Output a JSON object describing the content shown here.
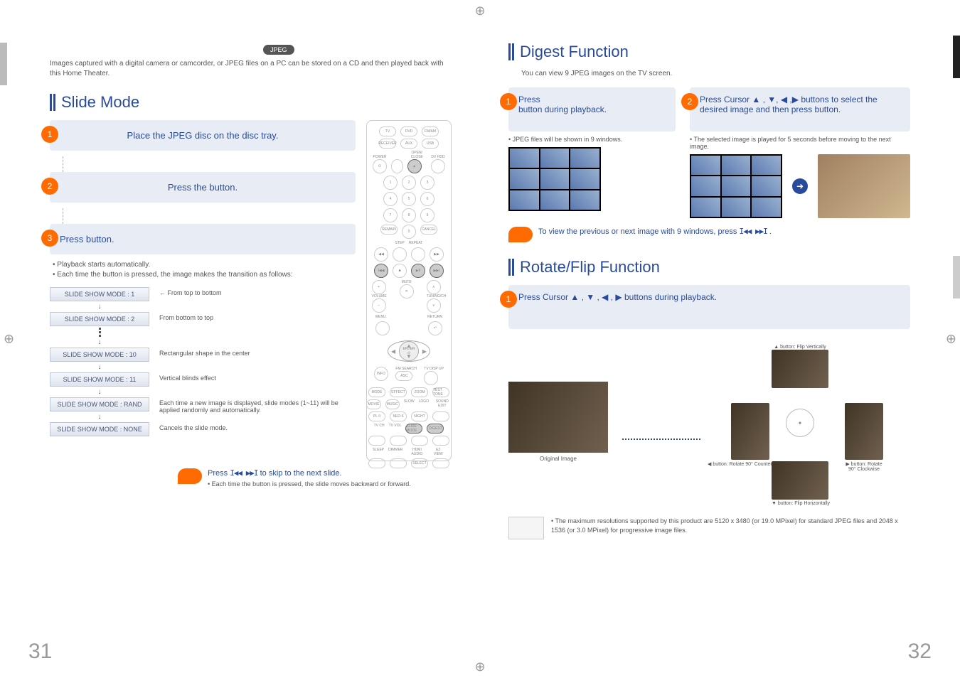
{
  "left": {
    "jpeg_badge": "JPEG",
    "intro": "Images captured with a digital camera or camcorder, or JPEG files on a PC can be stored on a CD and then played back with this Home Theater.",
    "section_title": "Slide Mode",
    "step1": "Place the JPEG disc on the disc tray.",
    "step2_pre": "Press the ",
    "step2_post": " button.",
    "step3_pre": "Press ",
    "step3_post": " button.",
    "bullet1": "• Playback starts automatically.",
    "bullet2": "• Each time the button is pressed, the image makes the transition as follows:",
    "modes": {
      "m1": "SLIDE SHOW MODE : 1",
      "d1": "From top to bottom",
      "m2": "SLIDE SHOW MODE : 2",
      "d2": "From bottom to top",
      "m10": "SLIDE SHOW MODE : 10",
      "d10": "Rectangular shape in the center",
      "m11": "SLIDE SHOW MODE : 11",
      "d11": "Vertical blinds effect",
      "mr": "SLIDE SHOW MODE : RAND",
      "dr": "Each time a new image is displayed, slide modes (1~11) will be applied randomly and automatically.",
      "mn": "SLIDE SHOW MODE : NONE",
      "dn": "Cancels the slide mode."
    },
    "tip_press_pre": "Press ",
    "tip_press_post": " to skip to the next slide.",
    "tip_detail": "• Each time the button is pressed, the slide moves backward or forward.",
    "page_num": "31",
    "remote": {
      "tv": "TV",
      "dvd": "DVD",
      "fmam": "FM/AM",
      "receiver": "RECEIVER",
      "aux": "AUX",
      "usb": "USB",
      "power": "POWER",
      "openclose": "OPEN/\nCLOSE",
      "dvhdd": "DV HDD",
      "numbers": [
        "1",
        "2",
        "3",
        "4",
        "5",
        "6",
        "7",
        "8",
        "9",
        "0"
      ],
      "remain": "REMAIN",
      "cancel": "CANCEL",
      "step": "STEP",
      "repeat": "REPEAT",
      "mute": "MUTE",
      "volume": "VOLUME",
      "tuning": "TUNING/CH",
      "menu": "MENU",
      "return": "RETURN",
      "enter": "ENTER",
      "info": "INFO",
      "fmsearch": "FM SEARCH",
      "tvdispup": "TV DISP UP",
      "asc": "ASC",
      "mode": "MODE",
      "movie": "MOVIE",
      "music": "MUSIC",
      "neo6": "NEO:6",
      "effect": "EFFECT",
      "pls": "PL II",
      "slow": "SLOW",
      "night": "NIGHT",
      "logo": "LOGO",
      "soundedit": "SOUND EDIT",
      "tvch": "TV CH",
      "tvvol": "TV VOL",
      "slidemode": "SLIDE MODE",
      "digest": "DIGEST",
      "zoom": "ZOOM",
      "testtone": "TEST TONE",
      "sleep": "SLEEP",
      "dimmer": "DIMMER",
      "hdmiaudio": "HDMI AUDIO",
      "ezview": "EZ VIEW",
      "select": "SELECT"
    }
  },
  "right": {
    "digest_title": "Digest Function",
    "digest_sub": "You can view 9 JPEG images on the TV screen.",
    "d1_press": "Press ",
    "d1_post": "button during playback.",
    "d2_pre": "Press Cursor ",
    "d2_mid": " buttons to select the desired image and then press ",
    "d2_post": " button.",
    "d1_bullet": "• JPEG files will be shown in 9 windows.",
    "d2_bullet": "• The selected image is played for 5 seconds before moving to the next image.",
    "tip_pre": "To view the previous or next image with 9 windows, press",
    "tip_post": ".",
    "rotate_title": "Rotate/Flip Function",
    "rotate_step": "Press Cursor ",
    "rotate_step_post": " buttons during playback.",
    "orig_cap": "Original Image",
    "r_up": "▲ button: Flip Vertically",
    "r_left": "◀ button: Rotate 90° Counterclockwise",
    "r_right": "▶ button: Rotate 90° Clockwise",
    "r_down": "▼ button: Flip Horizontally",
    "note": "• The maximum resolutions supported by this product are 5120 x 3480 (or 19.0 MPixel) for standard JPEG files and 2048 x 1536 (or 3.0 MPixel) for progressive image files.",
    "page_num": "32",
    "glyphs": {
      "up": "▲",
      "down": "▼",
      "left": "◀",
      "right": "▶",
      "prev": "I◀◀",
      "next": "▶▶I"
    }
  }
}
